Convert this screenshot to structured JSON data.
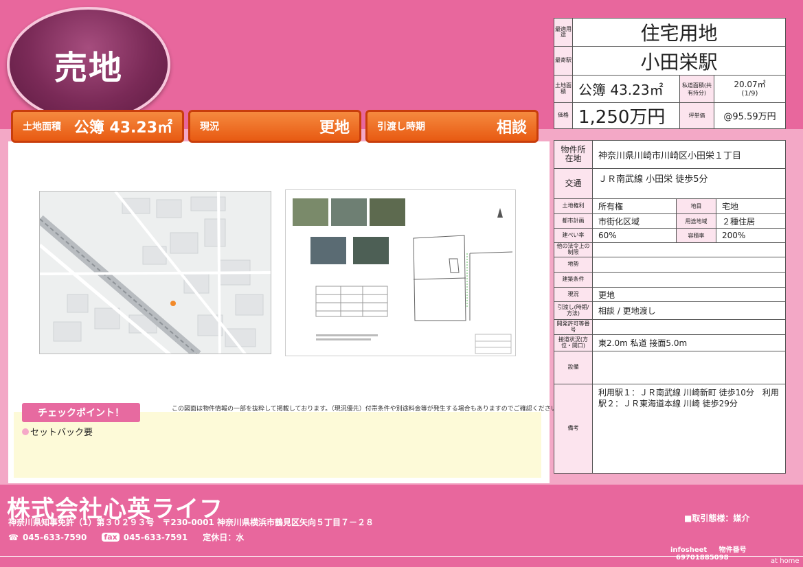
{
  "badge": {
    "label": "売地"
  },
  "pills": [
    {
      "label": "土地面積",
      "value": "公簿 43.23㎡"
    },
    {
      "label": "現況",
      "value": "更地"
    },
    {
      "label": "引渡し時期",
      "value": "相談"
    }
  ],
  "summary": {
    "usage_label": "最適用途",
    "usage": "住宅用地",
    "station_label": "最寄駅",
    "station": "小田栄駅",
    "area_label": "土地面積",
    "area": "公簿 43.23㎡",
    "private_road_label": "私道面積(共有持分)",
    "private_road_area": "20.07㎡",
    "private_road_share": "(1/9)",
    "price_label": "価格",
    "price": "1,250万円",
    "unit_price_label": "坪単価",
    "unit_price": "@95.59万円"
  },
  "details": {
    "address_label": "物件所在地",
    "address": "神奈川県川崎市川崎区小田栄１丁目",
    "traffic_label": "交通",
    "traffic": "ＪＲ南武線 小田栄 徒歩5分",
    "rights_label": "土地権利",
    "rights": "所有権",
    "land_cat_label": "地目",
    "land_cat": "宅地",
    "city_plan_label": "都市計画",
    "city_plan": "市街化区域",
    "zoning_label": "用途地域",
    "zoning": "２種住居",
    "bcr_label": "建ぺい率",
    "bcr": "60%",
    "far_label": "容積率",
    "far": "200%",
    "other_label": "他の法令上の制限",
    "terrain_label": "地勢",
    "build_cond_label": "建築条件",
    "status_label": "現況",
    "status": "更地",
    "handover_label": "引渡し(時期/方法)",
    "handover": "相談 / 更地渡し",
    "permit_label": "開発許可等番号",
    "road_label": "接道状況(方位・間口)",
    "road": "東2.0m 私道 接面5.0m",
    "facilities_label": "設備",
    "notes_label": "備考",
    "notes": "利用駅１：ＪＲ南武線 川崎新町 徒歩10分　利用駅２：ＪＲ東海道本線 川崎 徒歩29分"
  },
  "disclaimer": "この図面は物件情報の一部を抜粋して掲載しております。（現況優先）付帯条件や別途料金等が発生する場合もありますのでご確認ください。",
  "checkpoint": {
    "title": "チェックポイント！",
    "items": [
      "セットバック要"
    ]
  },
  "footer": {
    "company": "株式会社心英ライフ",
    "license": "神奈川県知事免許（1）第３０２９３号　〒230-0001 神奈川県横浜市鶴見区矢向５丁目７－２８",
    "tel": "045-633-7590",
    "fax_label": "fax",
    "fax": "045-633-7591",
    "holiday": "定休日：水",
    "deal_type": "■取引態様：媒介",
    "info_label": "infosheet",
    "id_label": "物件番号",
    "id": "69701885098",
    "brand": "at home"
  },
  "colors": {
    "pink": "#e8679d",
    "light_pink": "#f3a8c6",
    "orange": "#e85a12",
    "cell_pink": "#fce4ee"
  }
}
